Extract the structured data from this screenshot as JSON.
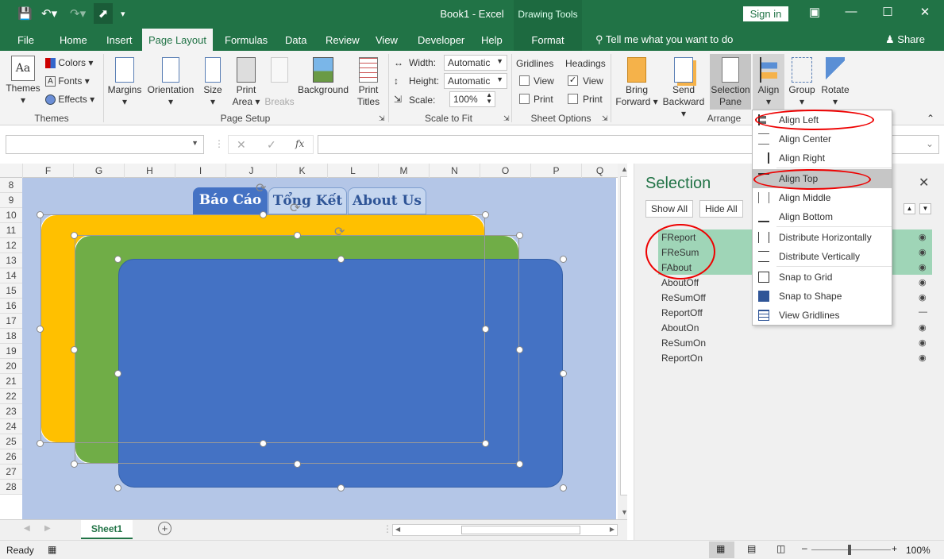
{
  "window": {
    "title": "Book1  -  Excel",
    "context_tab_group": "Drawing Tools",
    "sign_in": "Sign in"
  },
  "tabs": {
    "file": "File",
    "home": "Home",
    "insert": "Insert",
    "page_layout": "Page Layout",
    "formulas": "Formulas",
    "data": "Data",
    "review": "Review",
    "view": "View",
    "developer": "Developer",
    "help": "Help",
    "format": "Format",
    "tell_me": "Tell me what you want to do",
    "share": "Share"
  },
  "ribbon": {
    "themes": {
      "themes": "Themes",
      "colors": "Colors",
      "fonts": "Fonts",
      "effects": "Effects",
      "group": "Themes"
    },
    "page_setup": {
      "margins": "Margins",
      "orientation": "Orientation",
      "size": "Size",
      "print_area_1": "Print",
      "print_area_2": "Area",
      "breaks": "Breaks",
      "background": "Background",
      "print_titles_1": "Print",
      "print_titles_2": "Titles",
      "group": "Page Setup"
    },
    "scale": {
      "width_label": "Width:",
      "width_value": "Automatic",
      "height_label": "Height:",
      "height_value": "Automatic",
      "scale_label": "Scale:",
      "scale_value": "100%",
      "group": "Scale to Fit"
    },
    "sheet_options": {
      "gridlines": "Gridlines",
      "headings": "Headings",
      "view1": "View",
      "print1": "Print",
      "view2": "View",
      "print2": "Print",
      "group": "Sheet Options"
    },
    "arrange": {
      "bring_1": "Bring",
      "bring_2": "Forward",
      "send_1": "Send",
      "send_2": "Backward",
      "sel_1": "Selection",
      "sel_2": "Pane",
      "align": "Align",
      "group_btn": "Group",
      "rotate": "Rotate",
      "group": "Arrange"
    }
  },
  "formula_bar": {
    "fx": "fx"
  },
  "columns": [
    "F",
    "G",
    "H",
    "I",
    "J",
    "K",
    "L",
    "M",
    "N",
    "O",
    "P",
    "Q"
  ],
  "rows": [
    "8",
    "9",
    "10",
    "11",
    "12",
    "13",
    "14",
    "15",
    "16",
    "17",
    "18",
    "19",
    "20",
    "21",
    "22",
    "23",
    "24",
    "25",
    "26",
    "27",
    "28"
  ],
  "shapes": {
    "tab1": "Báo Cáo",
    "tab2": "Tổng Kết",
    "tab3": "About Us"
  },
  "sheet_tabs": {
    "sheet1": "Sheet1"
  },
  "status": {
    "ready": "Ready",
    "zoom": "100%"
  },
  "selection_pane": {
    "title": "Selection",
    "show_all": "Show All",
    "hide_all": "Hide All",
    "items": [
      "FReport",
      "FReSum",
      "FAbout",
      "AboutOff",
      "ReSumOff",
      "ReportOff",
      "AboutOn",
      "ReSumOn",
      "ReportOn"
    ]
  },
  "align_menu": {
    "items": [
      "Align Left",
      "Align Center",
      "Align Right",
      "Align Top",
      "Align Middle",
      "Align Bottom",
      "Distribute Horizontally",
      "Distribute Vertically",
      "Snap to Grid",
      "Snap to Shape",
      "View Gridlines"
    ]
  },
  "colors": {
    "excel_green": "#217346",
    "sheet_bg": "#b4c6e7",
    "orange": "#ffc000",
    "green": "#70ad47",
    "blue": "#4472c4",
    "highlight": "#9fd5b7",
    "annotation": "#e00000"
  }
}
